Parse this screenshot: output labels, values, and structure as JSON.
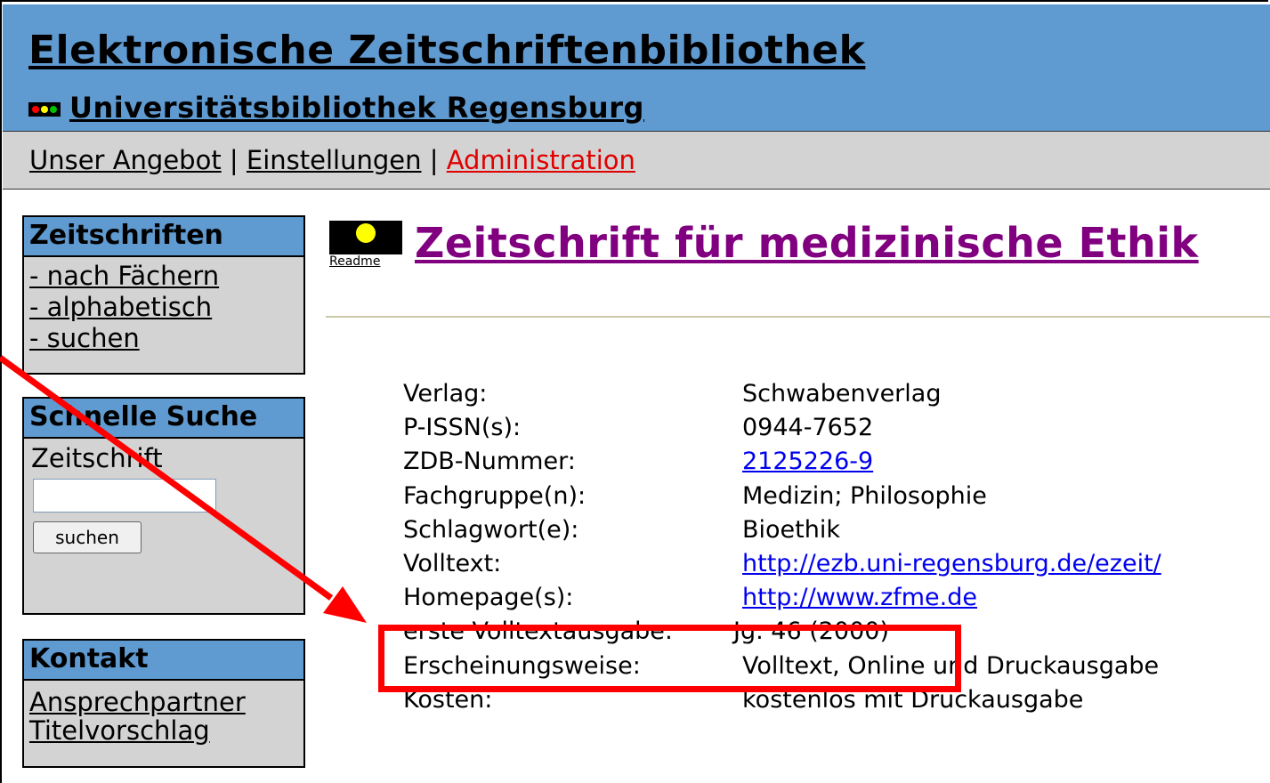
{
  "header": {
    "site_title": "Elektronische Zeitschriftenbibliothek",
    "institution": "Universitätsbibliothek Regensburg",
    "traffic_light_colors": [
      "#ff0000",
      "#ffff00",
      "#00c000"
    ]
  },
  "nav": {
    "items": [
      "Unser Angebot",
      "Einstellungen",
      "Administration"
    ],
    "separator": "|"
  },
  "sidebar": {
    "journals": {
      "heading": "Zeitschriften",
      "links": [
        "- nach Fächern",
        "- alphabetisch",
        "- suchen"
      ]
    },
    "quick_search": {
      "heading": "Schnelle Suche",
      "label": "Zeitschrift",
      "input_value": "",
      "button_label": "suchen"
    },
    "contact": {
      "heading": "Kontakt",
      "links": [
        "Ansprechpartner",
        "Titelvorschlag"
      ]
    }
  },
  "main": {
    "readme_label": "Readme",
    "journal_title": "Zeitschrift für medizinische Ethik",
    "details": [
      {
        "label": "Verlag:",
        "value": "Schwabenverlag"
      },
      {
        "label": "P-ISSN(s):",
        "value": "0944-7652"
      },
      {
        "label": "ZDB-Nummer:",
        "value": "2125226-9"
      },
      {
        "label": "Fachgruppe(n):",
        "value": "Medizin; Philosophie"
      },
      {
        "label": "Schlagwort(e):",
        "value": "Bioethik"
      },
      {
        "label": "Volltext:",
        "value": "http://ezb.uni-regensburg.de/ezeit/"
      },
      {
        "label": "Homepage(s):",
        "value": "http://www.zfme.de"
      },
      {
        "label": "erste Volltextausgabe:",
        "value": "Jg. 46 (2000)"
      },
      {
        "label": "Erscheinungsweise:",
        "value": "Volltext, Online und Druckausgabe"
      },
      {
        "label": "Kosten:",
        "value": "kostenlos mit Druckausgabe"
      }
    ]
  },
  "colors": {
    "header_blue": "#5f9ad0",
    "nav_gray": "#d3d3d3",
    "title_purple": "#800080",
    "link_blue": "#0000ee",
    "admin_red": "#e00000",
    "annotation_red": "#ff0000"
  }
}
